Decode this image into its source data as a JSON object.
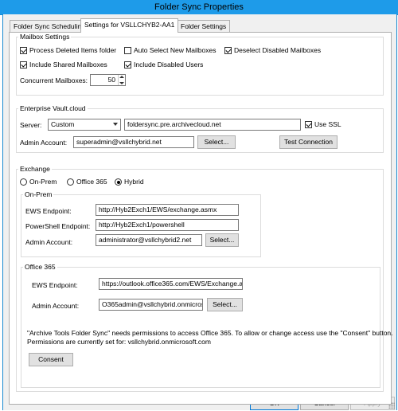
{
  "window": {
    "title": "Folder Sync Properties"
  },
  "tabs": [
    {
      "label": "Folder Sync Scheduling"
    },
    {
      "label": "Settings for VSLLCHYB2-AA1"
    },
    {
      "label": "Folder Settings"
    }
  ],
  "mailbox_settings": {
    "label": "Mailbox Settings",
    "process_deleted": {
      "label": "Process Deleted Items folder",
      "checked": true
    },
    "auto_select_new": {
      "label": "Auto Select New Mailboxes",
      "checked": false
    },
    "deselect_disabled": {
      "label": "Deselect Disabled Mailboxes",
      "checked": true
    },
    "include_shared": {
      "label": "Include Shared Mailboxes",
      "checked": true
    },
    "include_disabled_users": {
      "label": "Include Disabled Users",
      "checked": true
    },
    "concurrent_label": "Concurrent Mailboxes:",
    "concurrent_value": "50"
  },
  "enterprise_vault": {
    "label": "Enterprise Vault.cloud",
    "server_label": "Server:",
    "server_type": "Custom",
    "server_value": "foldersync.pre.archivecloud.net",
    "use_ssl": {
      "label": "Use SSL",
      "checked": true
    },
    "admin_label": "Admin Account:",
    "admin_value": "superadmin@vsllchybrid.net",
    "select_label": "Select...",
    "test_label": "Test Connection"
  },
  "exchange": {
    "label": "Exchange",
    "options": [
      {
        "label": "On-Prem",
        "selected": false
      },
      {
        "label": "Office 365",
        "selected": false
      },
      {
        "label": "Hybrid",
        "selected": true
      }
    ],
    "on_prem": {
      "label": "On-Prem",
      "ews_label": "EWS Endpoint:",
      "ews_value": "http://Hyb2Exch1/EWS/exchange.asmx",
      "ps_label": "PowerShell Endpoint:",
      "ps_value": "http://Hyb2Exch1/powershell",
      "admin_label": "Admin Account:",
      "admin_value": "administrator@vsllchybrid2.net",
      "select_label": "Select..."
    },
    "office365": {
      "label": "Office 365",
      "ews_label": "EWS Endpoint:",
      "ews_value": "https://outlook.office365.com/EWS/Exchange.a",
      "admin_label": "Admin Account:",
      "admin_value": "O365admin@vsllchybrid.onmicros",
      "select_label": "Select...",
      "note_line1": "\"Archive Tools Folder Sync\" needs permissions to access Office 365. To allow or change access use the \"Consent\" button.",
      "note_line2": "Permissions are currently set for:   vsllchybrid.onmicrosoft.com",
      "consent_label": "Consent"
    }
  },
  "footer": {
    "ok": "OK",
    "cancel": "Cancel",
    "apply": "Apply"
  }
}
